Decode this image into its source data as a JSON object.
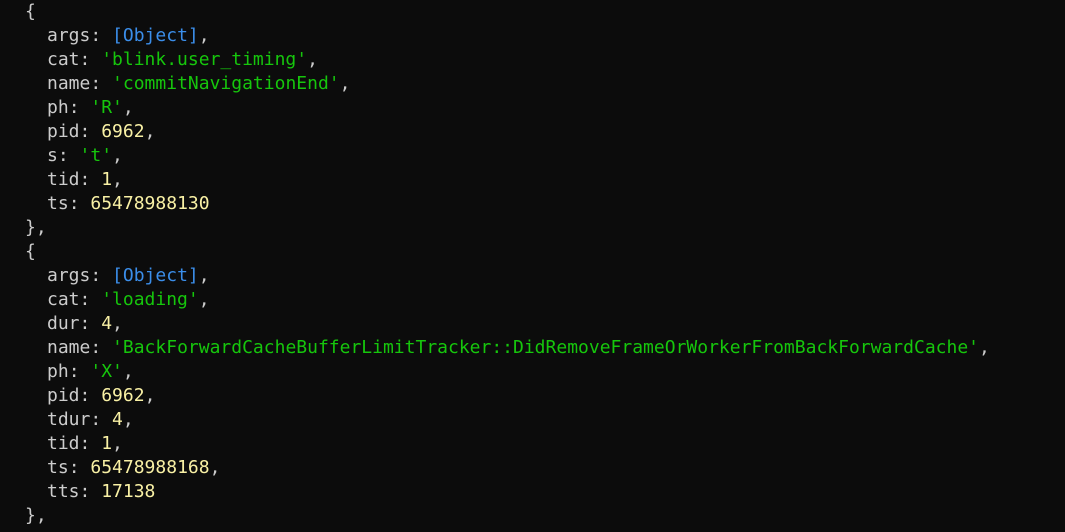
{
  "console": {
    "records": [
      {
        "open": "{",
        "close": "},",
        "fields": [
          {
            "key": "args",
            "value": "[Object]",
            "kind": "obj"
          },
          {
            "key": "cat",
            "value": "'blink.user_timing'",
            "kind": "str"
          },
          {
            "key": "name",
            "value": "'commitNavigationEnd'",
            "kind": "str"
          },
          {
            "key": "ph",
            "value": "'R'",
            "kind": "str"
          },
          {
            "key": "pid",
            "value": "6962",
            "kind": "num"
          },
          {
            "key": "s",
            "value": "'t'",
            "kind": "str"
          },
          {
            "key": "tid",
            "value": "1",
            "kind": "num"
          },
          {
            "key": "ts",
            "value": "65478988130",
            "kind": "num",
            "last": true
          }
        ]
      },
      {
        "open": "{",
        "close": "},",
        "fields": [
          {
            "key": "args",
            "value": "[Object]",
            "kind": "obj"
          },
          {
            "key": "cat",
            "value": "'loading'",
            "kind": "str"
          },
          {
            "key": "dur",
            "value": "4",
            "kind": "num"
          },
          {
            "key": "name",
            "value": "'BackForwardCacheBufferLimitTracker::DidRemoveFrameOrWorkerFromBackForwardCache'",
            "kind": "str"
          },
          {
            "key": "ph",
            "value": "'X'",
            "kind": "str"
          },
          {
            "key": "pid",
            "value": "6962",
            "kind": "num"
          },
          {
            "key": "tdur",
            "value": "4",
            "kind": "num"
          },
          {
            "key": "tid",
            "value": "1",
            "kind": "num"
          },
          {
            "key": "ts",
            "value": "65478988168",
            "kind": "num"
          },
          {
            "key": "tts",
            "value": "17138",
            "kind": "num",
            "last": true
          }
        ]
      }
    ]
  },
  "colors": {
    "background": "#0c0c0c",
    "text": "#cccccc",
    "object": "#3b8eea",
    "string": "#16c60c",
    "number": "#f9f1a5"
  }
}
